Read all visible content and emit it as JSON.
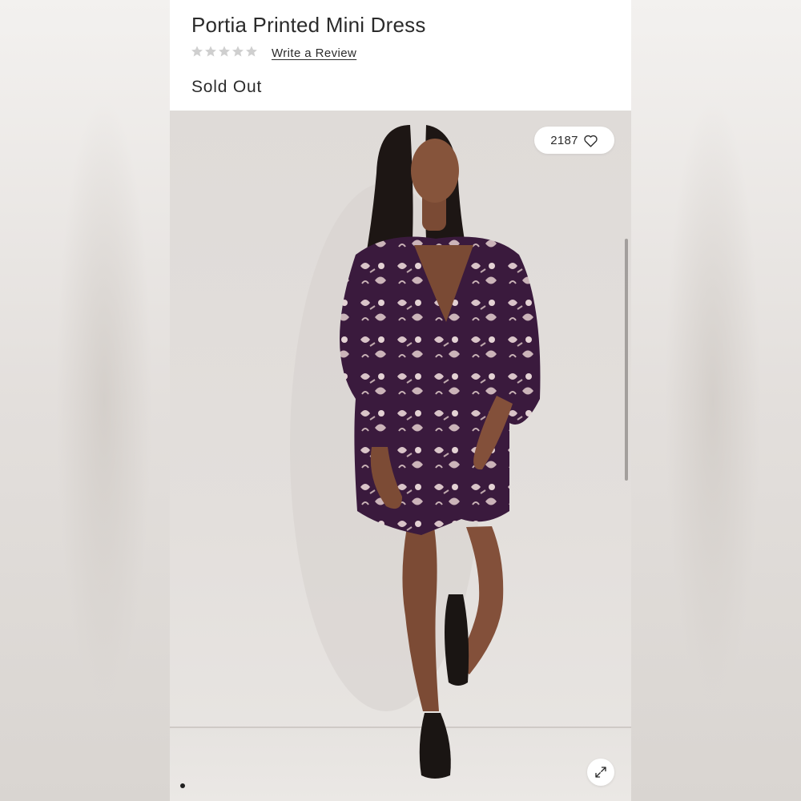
{
  "product": {
    "title": "Portia Printed Mini Dress",
    "rating": {
      "stars": 0,
      "max_stars": 5,
      "write_review_label": "Write a Review"
    },
    "status": "Sold Out"
  },
  "gallery": {
    "likes_count": "2187",
    "current_image": 1,
    "image_count": 1,
    "icons": {
      "like": "heart-icon",
      "expand": "expand-arrows-icon"
    }
  },
  "colors": {
    "text": "#2b2b2b",
    "star_empty": "#cccccc",
    "dress_purple": "#3b1a3e",
    "background_wall": "#dfdbd8"
  }
}
